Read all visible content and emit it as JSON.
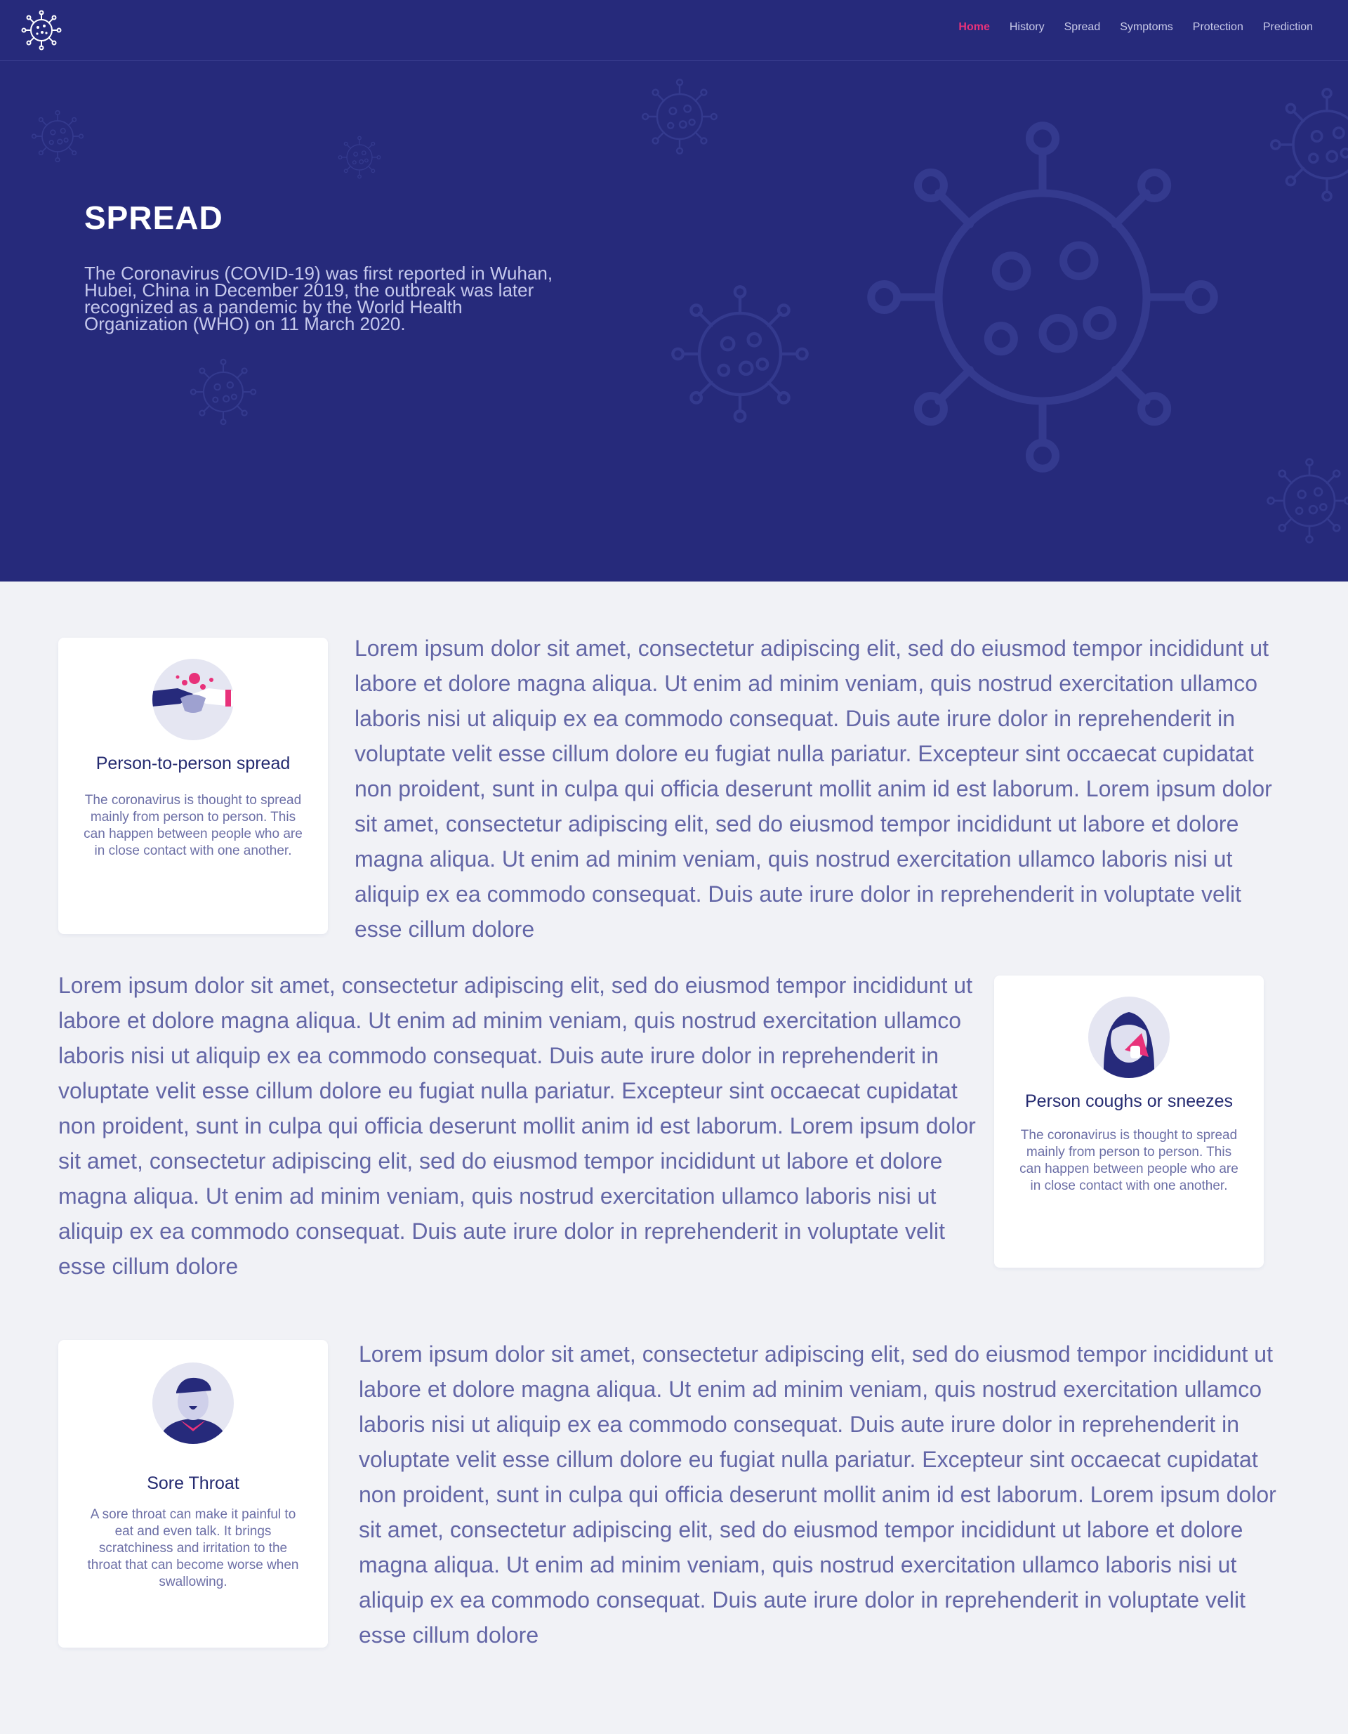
{
  "nav": {
    "logo_icon": "virus-logo-icon",
    "items": [
      "Home",
      "History",
      "Spread",
      "Symptoms",
      "Protection",
      "Prediction"
    ],
    "active": "Home",
    "colors": {
      "background": "#262a7b",
      "active": "#e8327a",
      "link": "#c8cae8"
    }
  },
  "hero": {
    "title": "SPREAD",
    "text": "The Coronavirus (COVID-19) was first reported in Wuhan, Hubei, China in December 2019, the outbreak was later recognized as a pandemic by the World Health Organization (WHO) on 11 March 2020."
  },
  "sections": [
    {
      "card": {
        "icon": "handshake-icon",
        "title": "Person-to-person spread",
        "desc": "The coronavirus is thought to spread mainly from person to person. This can happen between people who are in close contact with one another."
      },
      "text": "Lorem ipsum dolor sit amet, consectetur adipiscing elit, sed do eiusmod tempor incididunt ut labore et dolore magna aliqua. Ut enim ad minim veniam, quis nostrud exercitation ullamco laboris nisi ut aliquip ex ea commodo consequat. Duis aute irure dolor in reprehenderit in voluptate velit esse cillum dolore eu fugiat nulla pariatur. Excepteur sint occaecat cupidatat non proident, sunt in culpa qui officia deserunt mollit anim id est laborum. Lorem ipsum dolor sit amet, consectetur adipiscing elit, sed do eiusmod tempor incididunt ut labore et dolore magna aliqua. Ut enim ad minim veniam, quis nostrud exercitation ullamco laboris nisi ut aliquip ex ea commodo consequat. Duis aute irure dolor in reprehenderit in voluptate velit esse cillum dolore"
    },
    {
      "card": {
        "icon": "sneezing-person-icon",
        "title": "Person coughs or sneezes",
        "desc": "The coronavirus is thought to spread mainly from person to person. This can happen between people who are in close contact with one another."
      },
      "text": "Lorem ipsum dolor sit amet, consectetur adipiscing elit, sed do eiusmod tempor incididunt ut labore et dolore magna aliqua. Ut enim ad minim veniam, quis nostrud exercitation ullamco laboris nisi ut aliquip ex ea commodo consequat. Duis aute irure dolor in reprehenderit in voluptate velit esse cillum dolore eu fugiat nulla pariatur. Excepteur sint occaecat cupidatat non proident, sunt in culpa qui officia deserunt mollit anim id est laborum. Lorem ipsum dolor sit amet, consectetur adipiscing elit, sed do eiusmod tempor incididunt ut labore et dolore magna aliqua. Ut enim ad minim veniam, quis nostrud exercitation ullamco laboris nisi ut aliquip ex ea commodo consequat. Duis aute irure dolor in reprehenderit in voluptate velit esse cillum dolore"
    },
    {
      "card": {
        "icon": "sore-throat-icon",
        "title": "Sore Throat",
        "desc": "A sore throat can make it painful to eat and even talk. It brings scratchiness and irritation to the throat that can become worse when swallowing."
      },
      "text": "Lorem ipsum dolor sit amet, consectetur adipiscing elit, sed do eiusmod tempor incididunt ut labore et dolore magna aliqua. Ut enim ad minim veniam, quis nostrud exercitation ullamco laboris nisi ut aliquip ex ea commodo consequat. Duis aute irure dolor in reprehenderit in voluptate velit esse cillum dolore eu fugiat nulla pariatur. Excepteur sint occaecat cupidatat non proident, sunt in culpa qui officia deserunt mollit anim id est laborum. Lorem ipsum dolor sit amet, consectetur adipiscing elit, sed do eiusmod tempor incididunt ut labore et dolore magna aliqua. Ut enim ad minim veniam, quis nostrud exercitation ullamco laboris nisi ut aliquip ex ea commodo consequat. Duis aute irure dolor in reprehenderit in voluptate velit esse cillum dolore"
    }
  ],
  "colors": {
    "page_background": "#f1f2f6",
    "card_background": "#ffffff",
    "accent": "#e8327a",
    "text": "#6366a6",
    "heading": "#242a70"
  }
}
